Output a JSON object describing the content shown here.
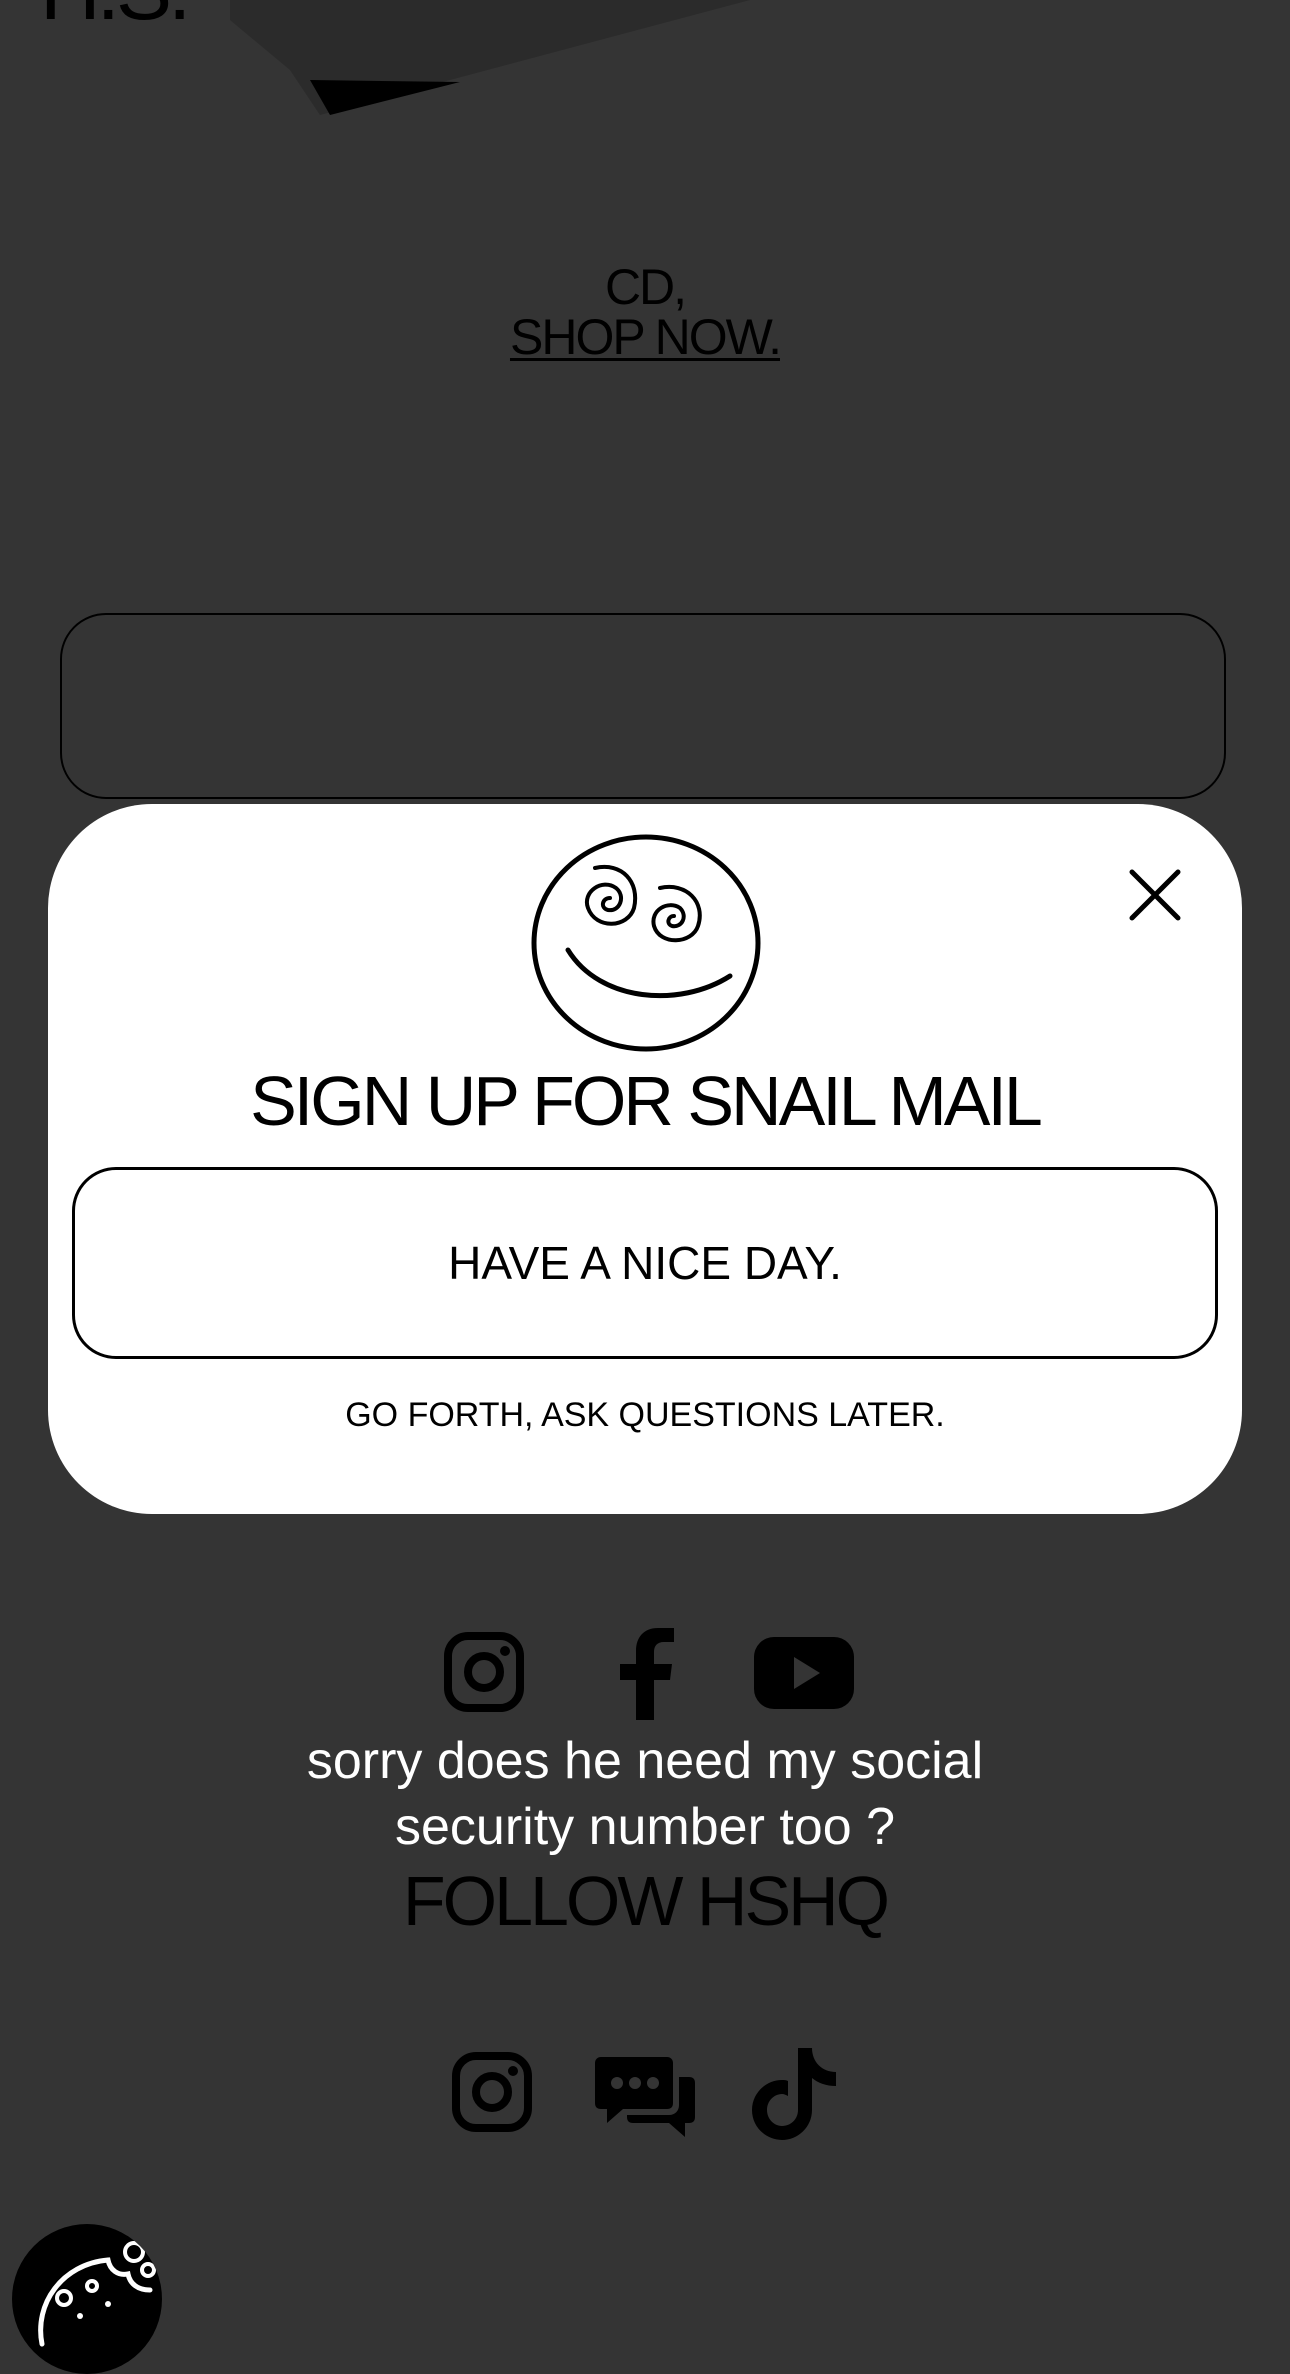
{
  "header": {
    "logo_text": "H.S."
  },
  "hero": {
    "line1": "CD,",
    "shop_link": "SHOP NOW."
  },
  "modal": {
    "title": "SIGN UP FOR SNAIL MAIL",
    "primary_button": "HAVE A NICE DAY.",
    "secondary_link": "GO FORTH, ASK QUESTIONS LATER."
  },
  "footer": {
    "tagline_line1": "sorry does he need my social",
    "tagline_line2": "security number too ?",
    "follow_label": "FOLLOW HSHQ"
  },
  "icons": {
    "row1": [
      "instagram-icon",
      "facebook-icon",
      "youtube-icon"
    ],
    "row2": [
      "instagram-icon",
      "chat-icon",
      "tiktok-icon"
    ],
    "modal": [
      "smiley-icon",
      "close-icon"
    ],
    "cookie": "cookie-icon"
  },
  "colors": {
    "background": "#343434",
    "modal": "#ffffff",
    "text_dark": "#000000",
    "text_light": "#ffffff"
  }
}
